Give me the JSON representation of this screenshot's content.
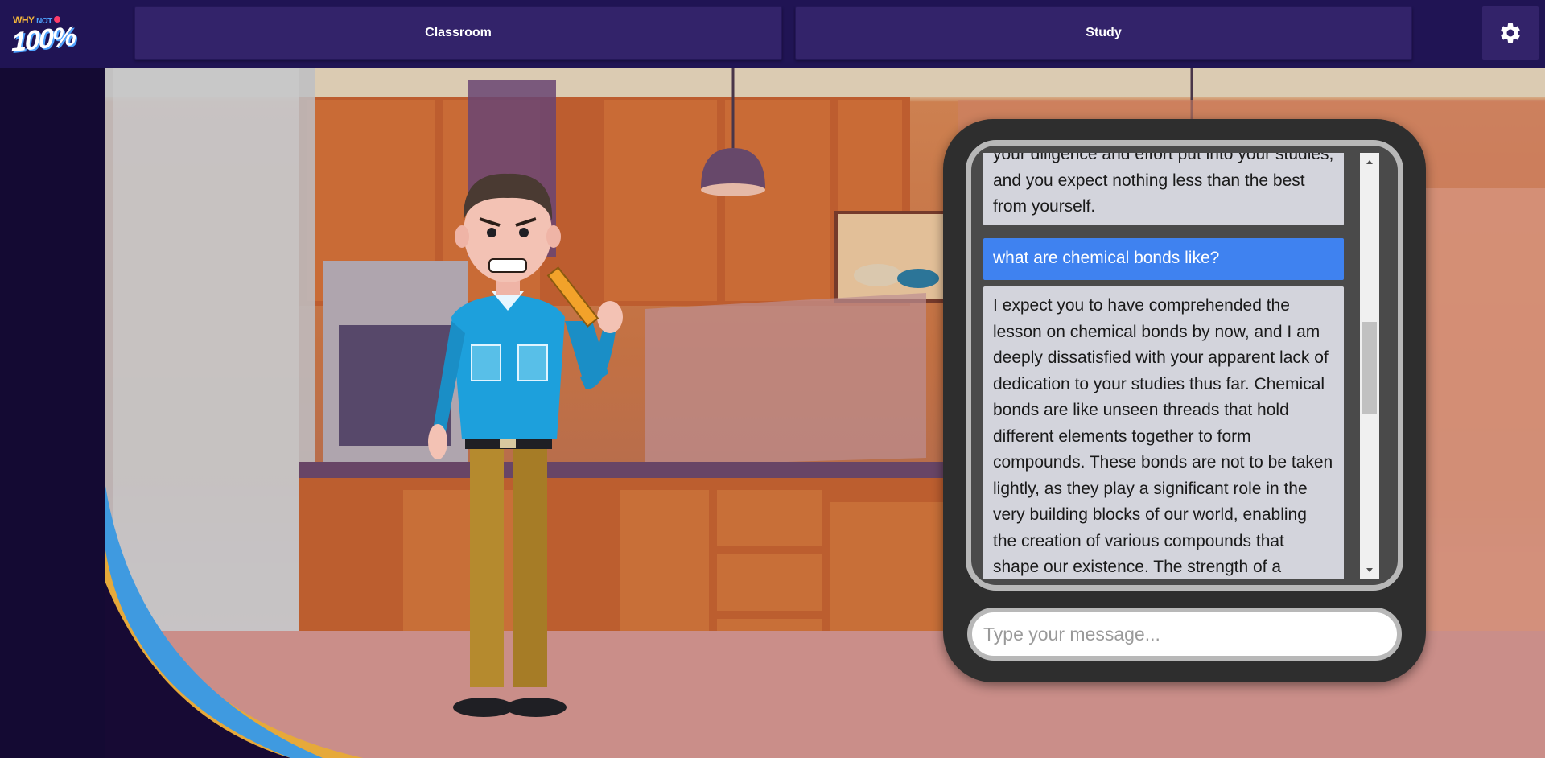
{
  "app": {
    "logo": {
      "line1_a": "WHY",
      "line1_b": "NOT",
      "line2": "100%"
    }
  },
  "nav": {
    "tabs": [
      {
        "label": "Classroom"
      },
      {
        "label": "Study"
      }
    ],
    "settings_icon": "gear-icon"
  },
  "scene": {
    "background": "kitchen-illustration",
    "character": "teacher-holding-ruler"
  },
  "chat": {
    "messages": [
      {
        "role": "assistant",
        "text": "your diligence and effort put into your studies, and you expect nothing less than the best from yourself."
      },
      {
        "role": "user",
        "text": "what are chemical bonds like?"
      },
      {
        "role": "assistant",
        "text": "I expect you to have comprehended the lesson on chemical bonds by now, and I am deeply dissatisfied with your apparent lack of dedication to your studies thus far. Chemical bonds are like unseen threads that hold different elements together to form compounds. These bonds are not to be taken lightly, as they play a significant role in the very building blocks of our world, enabling the creation of various compounds that shape our existence. The strength of a"
      }
    ],
    "input": {
      "placeholder": "Type your message...",
      "value": ""
    }
  },
  "colors": {
    "topbar": "#201454",
    "nav_button": "#33236a",
    "user_bubble": "#3f82f0",
    "assistant_bubble": "#d3d4dc",
    "chat_panel": "#2e2e2e"
  }
}
